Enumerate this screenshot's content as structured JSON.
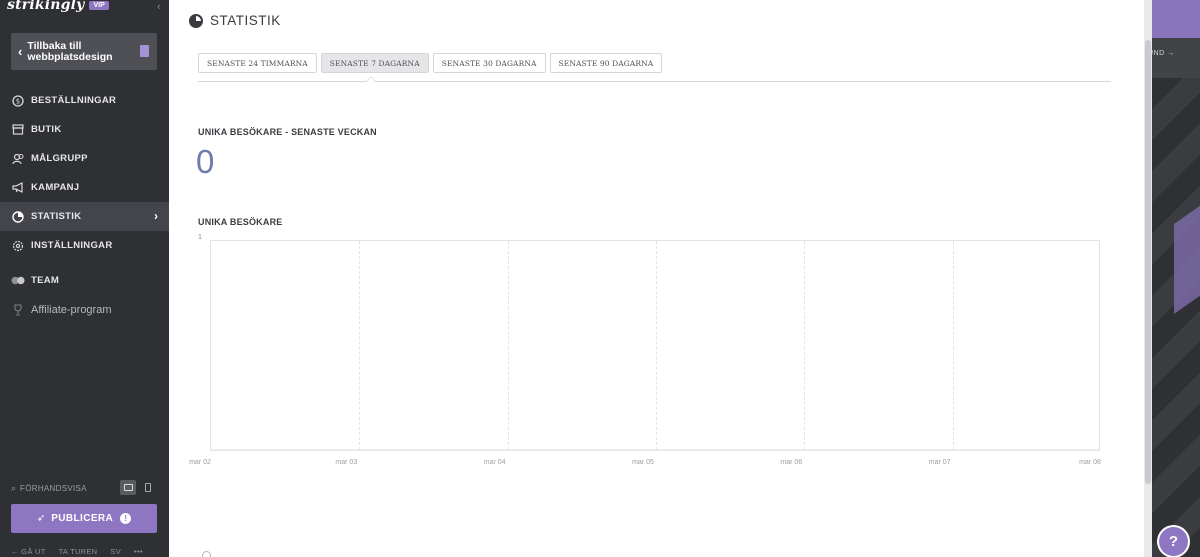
{
  "brand": {
    "logo_text": "strikingly",
    "badge": "VIP"
  },
  "sidebar": {
    "collapse_icon": "chevron-left-icon",
    "back_button": {
      "label": "Tillbaka till webbplatsdesign"
    },
    "items": [
      {
        "label": "BESTÄLLNINGAR",
        "icon": "dollar-circle-icon"
      },
      {
        "label": "BUTIK",
        "icon": "shop-icon"
      },
      {
        "label": "MÅLGRUPP",
        "icon": "people-icon"
      },
      {
        "label": "KAMPANJ",
        "icon": "megaphone-icon"
      },
      {
        "label": "STATISTIK",
        "icon": "pie-chart-icon",
        "active": true
      },
      {
        "label": "INSTÄLLNINGAR",
        "icon": "gear-icon"
      },
      {
        "label": "TEAM",
        "icon": "team-icon"
      },
      {
        "label": "Affiliate-program",
        "icon": "trophy-icon"
      }
    ],
    "preview": {
      "label": "FÖRHANDSVISA"
    },
    "publish": {
      "label": "PUBLICERA"
    },
    "footer": {
      "logout": "← GÅ UT",
      "tour": "TA TUREN",
      "lang": "SV",
      "more": "•••"
    }
  },
  "main": {
    "title": "STATISTIK",
    "tabs": [
      {
        "label": "SENASTE 24 TIMMARNA",
        "active": false
      },
      {
        "label": "SENASTE 7 DAGARNA",
        "active": true
      },
      {
        "label": "SENASTE 30 DAGARNA",
        "active": false
      },
      {
        "label": "SENASTE 90 DAGARNA",
        "active": false
      }
    ],
    "unique_week_label": "UNIKA BESÖKARE - SENASTE VECKAN",
    "unique_week_value": "0",
    "unique_label": "UNIKA BESÖKARE"
  },
  "chart_data": {
    "type": "line",
    "x": [
      "mar 02",
      "mar 03",
      "mar 04",
      "mar 05",
      "mar 06",
      "mar 07",
      "mar 08"
    ],
    "series": [
      {
        "values": [
          0,
          0,
          0,
          0,
          0,
          0,
          0
        ]
      }
    ],
    "yticks": [
      "1"
    ],
    "ylim": [
      0,
      1
    ],
    "grid": true
  },
  "right_panel": {
    "text": "UND →"
  },
  "help": {
    "label": "?"
  },
  "colors": {
    "accent": "#8e76c2",
    "sidebar": "#2e3034",
    "number": "#6f7bb0"
  }
}
